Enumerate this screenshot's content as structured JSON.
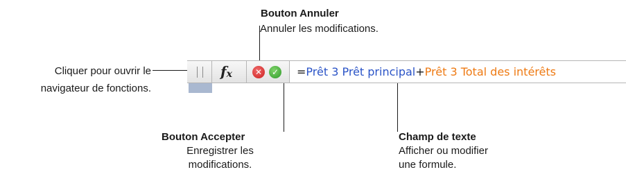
{
  "callouts": {
    "annuler": {
      "title": "Bouton Annuler",
      "desc": "Annuler les modifications."
    },
    "fonctions": {
      "line1": "Cliquer pour ouvrir le",
      "line2": "navigateur de fonctions."
    },
    "accepter": {
      "title": "Bouton Accepter",
      "desc1": "Enregistrer les",
      "desc2": "modifications."
    },
    "texte": {
      "title": "Champ de texte",
      "desc1": "Afficher ou modifier",
      "desc2": "une formule."
    }
  },
  "toolbar": {
    "fx_label": "f",
    "fx_sub": "x",
    "cancel_glyph": "✕",
    "accept_glyph": "✓",
    "formula": {
      "eq": "=",
      "ref1": "Prêt 3 Prêt principal",
      "plus": "+",
      "ref2": "Prêt 3 Total des intérêts"
    }
  },
  "colors": {
    "ref1": "#2b54c7",
    "ref2": "#ee7a13",
    "cancel": "#cc1f1f",
    "accept": "#2f9a2a"
  },
  "icons": {
    "grip": "grip-handle-icon",
    "fx": "function-fx-icon",
    "cancel": "cancel-x-icon",
    "accept": "accept-check-icon"
  }
}
